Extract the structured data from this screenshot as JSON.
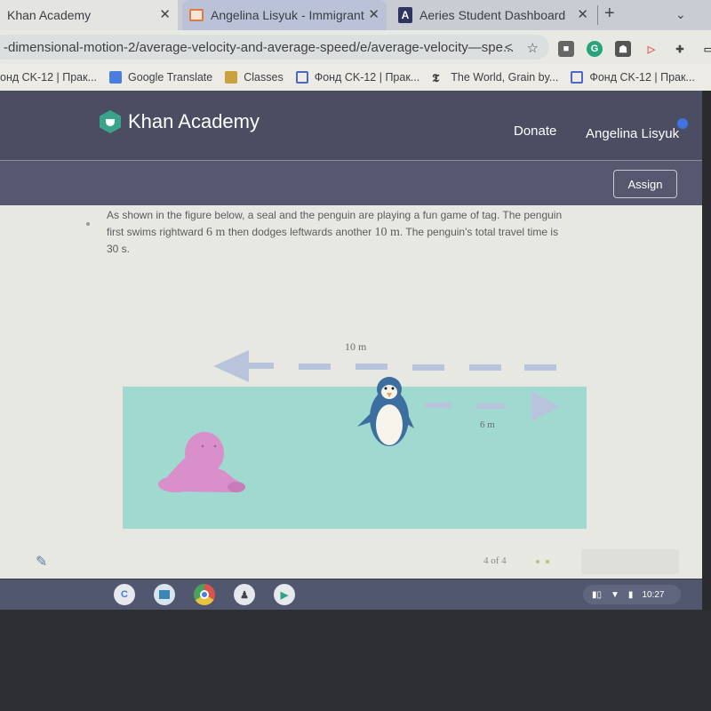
{
  "browser": {
    "tabs": [
      {
        "title": "Khan Academy",
        "active": true
      },
      {
        "title": "Angelina Lisyuk - Immigrant P",
        "active": false
      },
      {
        "title": "Aeries Student Dashboard",
        "active": false
      }
    ],
    "new_tab_icon": "plus-icon",
    "address": "-dimensional-motion-2/average-velocity-and-average-speed/e/average-velocity—spe...",
    "bookmarks": [
      {
        "label": "онд CK-12 | Прак...",
        "icon": "doc-icon"
      },
      {
        "label": "Google Translate",
        "icon": "translate-icon"
      },
      {
        "label": "Classes",
        "icon": "classroom-icon"
      },
      {
        "label": "Фонд CK-12 | Прак...",
        "icon": "doc-icon"
      },
      {
        "label": "The World, Grain by...",
        "icon": "nyt-icon"
      },
      {
        "label": "Фонд CK-12 | Прак...",
        "icon": "doc-icon"
      }
    ]
  },
  "ka": {
    "brand": "Khan Academy",
    "donate": "Donate",
    "user": "Angelina Lisyuk",
    "assign": "Assign",
    "accent": "#3aa38c"
  },
  "problem": {
    "line1": "As shown in the figure below, a seal and the penguin are playing a fun game of tag. The penguin",
    "line2_a": "first swims rightward ",
    "d1": "6 m",
    "line2_b": " then dodges leftwards another ",
    "d2": "10 m",
    "line2_c": ". The penguin's total travel time is",
    "line3": "30 s."
  },
  "figure": {
    "label_left": "10 m",
    "label_right": "6 m",
    "water_color": "#9fd9cf",
    "seal_color": "#d98fc9",
    "arrow_color": "#b8c4dc"
  },
  "footer": {
    "pager": "4 of 4"
  },
  "shelf": {
    "apps": [
      "C",
      "",
      "",
      "",
      ""
    ],
    "time": "10:27"
  }
}
